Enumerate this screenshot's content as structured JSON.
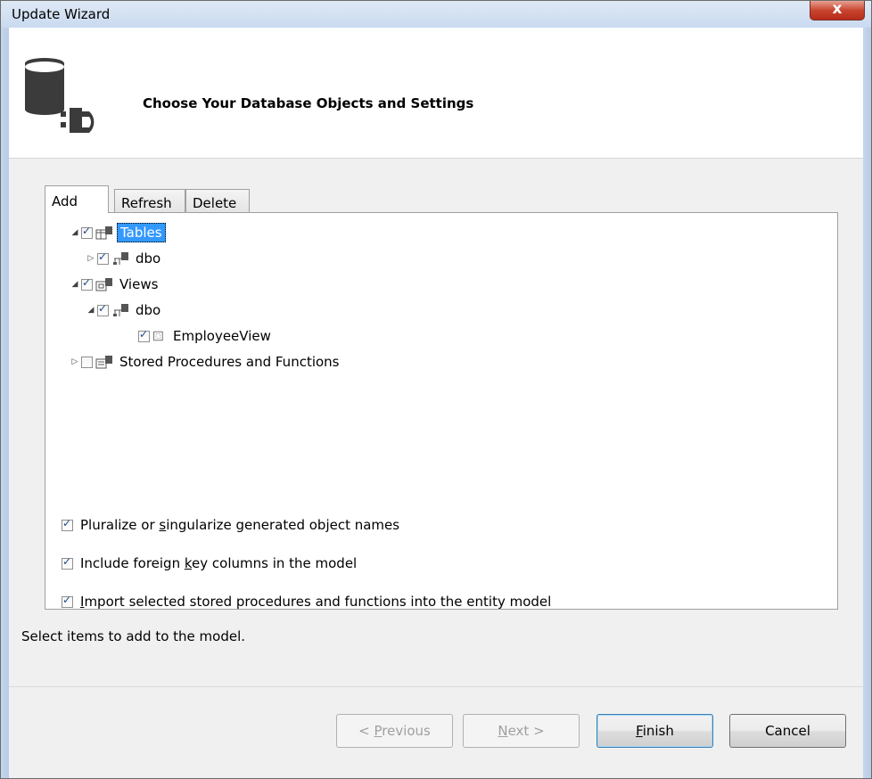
{
  "window": {
    "title": "Update Wizard",
    "close_label": "x"
  },
  "header": {
    "title": "Choose Your Database Objects and Settings",
    "icon": "database-connect-icon"
  },
  "tabs": [
    {
      "label": "Add",
      "active": true
    },
    {
      "label": "Refresh",
      "active": false
    },
    {
      "label": "Delete",
      "active": false
    }
  ],
  "tree": [
    {
      "label": "Tables",
      "checked": true,
      "expanded": true,
      "selected": true,
      "icon": "tables-icon"
    },
    {
      "label": "dbo",
      "checked": true,
      "expanded": false,
      "icon": "schema-icon"
    },
    {
      "label": "Views",
      "checked": true,
      "expanded": true,
      "icon": "views-icon"
    },
    {
      "label": "dbo",
      "checked": true,
      "expanded": true,
      "icon": "schema-icon"
    },
    {
      "label": "EmployeeView",
      "checked": true,
      "icon": "view-icon"
    },
    {
      "label": "Stored Procedures and Functions",
      "checked": false,
      "expanded": false,
      "icon": "procedures-icon"
    }
  ],
  "options": [
    {
      "pre": "Pluralize or ",
      "accel": "s",
      "post": "ingularize generated object names",
      "checked": true
    },
    {
      "pre": "Include foreign ",
      "accel": "k",
      "post": "ey columns in the model",
      "checked": true
    },
    {
      "pre": "",
      "accel": "I",
      "post": "mport selected stored procedures and functions into the entity model",
      "checked": true
    }
  ],
  "status": "Select items to add to the model.",
  "buttons": {
    "previous": {
      "pre": "< ",
      "accel": "P",
      "post": "revious",
      "enabled": false
    },
    "next": {
      "pre": "",
      "accel": "N",
      "post": "ext >",
      "enabled": false
    },
    "finish": {
      "pre": "",
      "accel": "F",
      "post": "inish",
      "enabled": true
    },
    "cancel": {
      "label": "Cancel",
      "enabled": true
    }
  },
  "colors": {
    "selection": "#3399ff",
    "close_button": "#c8452f"
  }
}
